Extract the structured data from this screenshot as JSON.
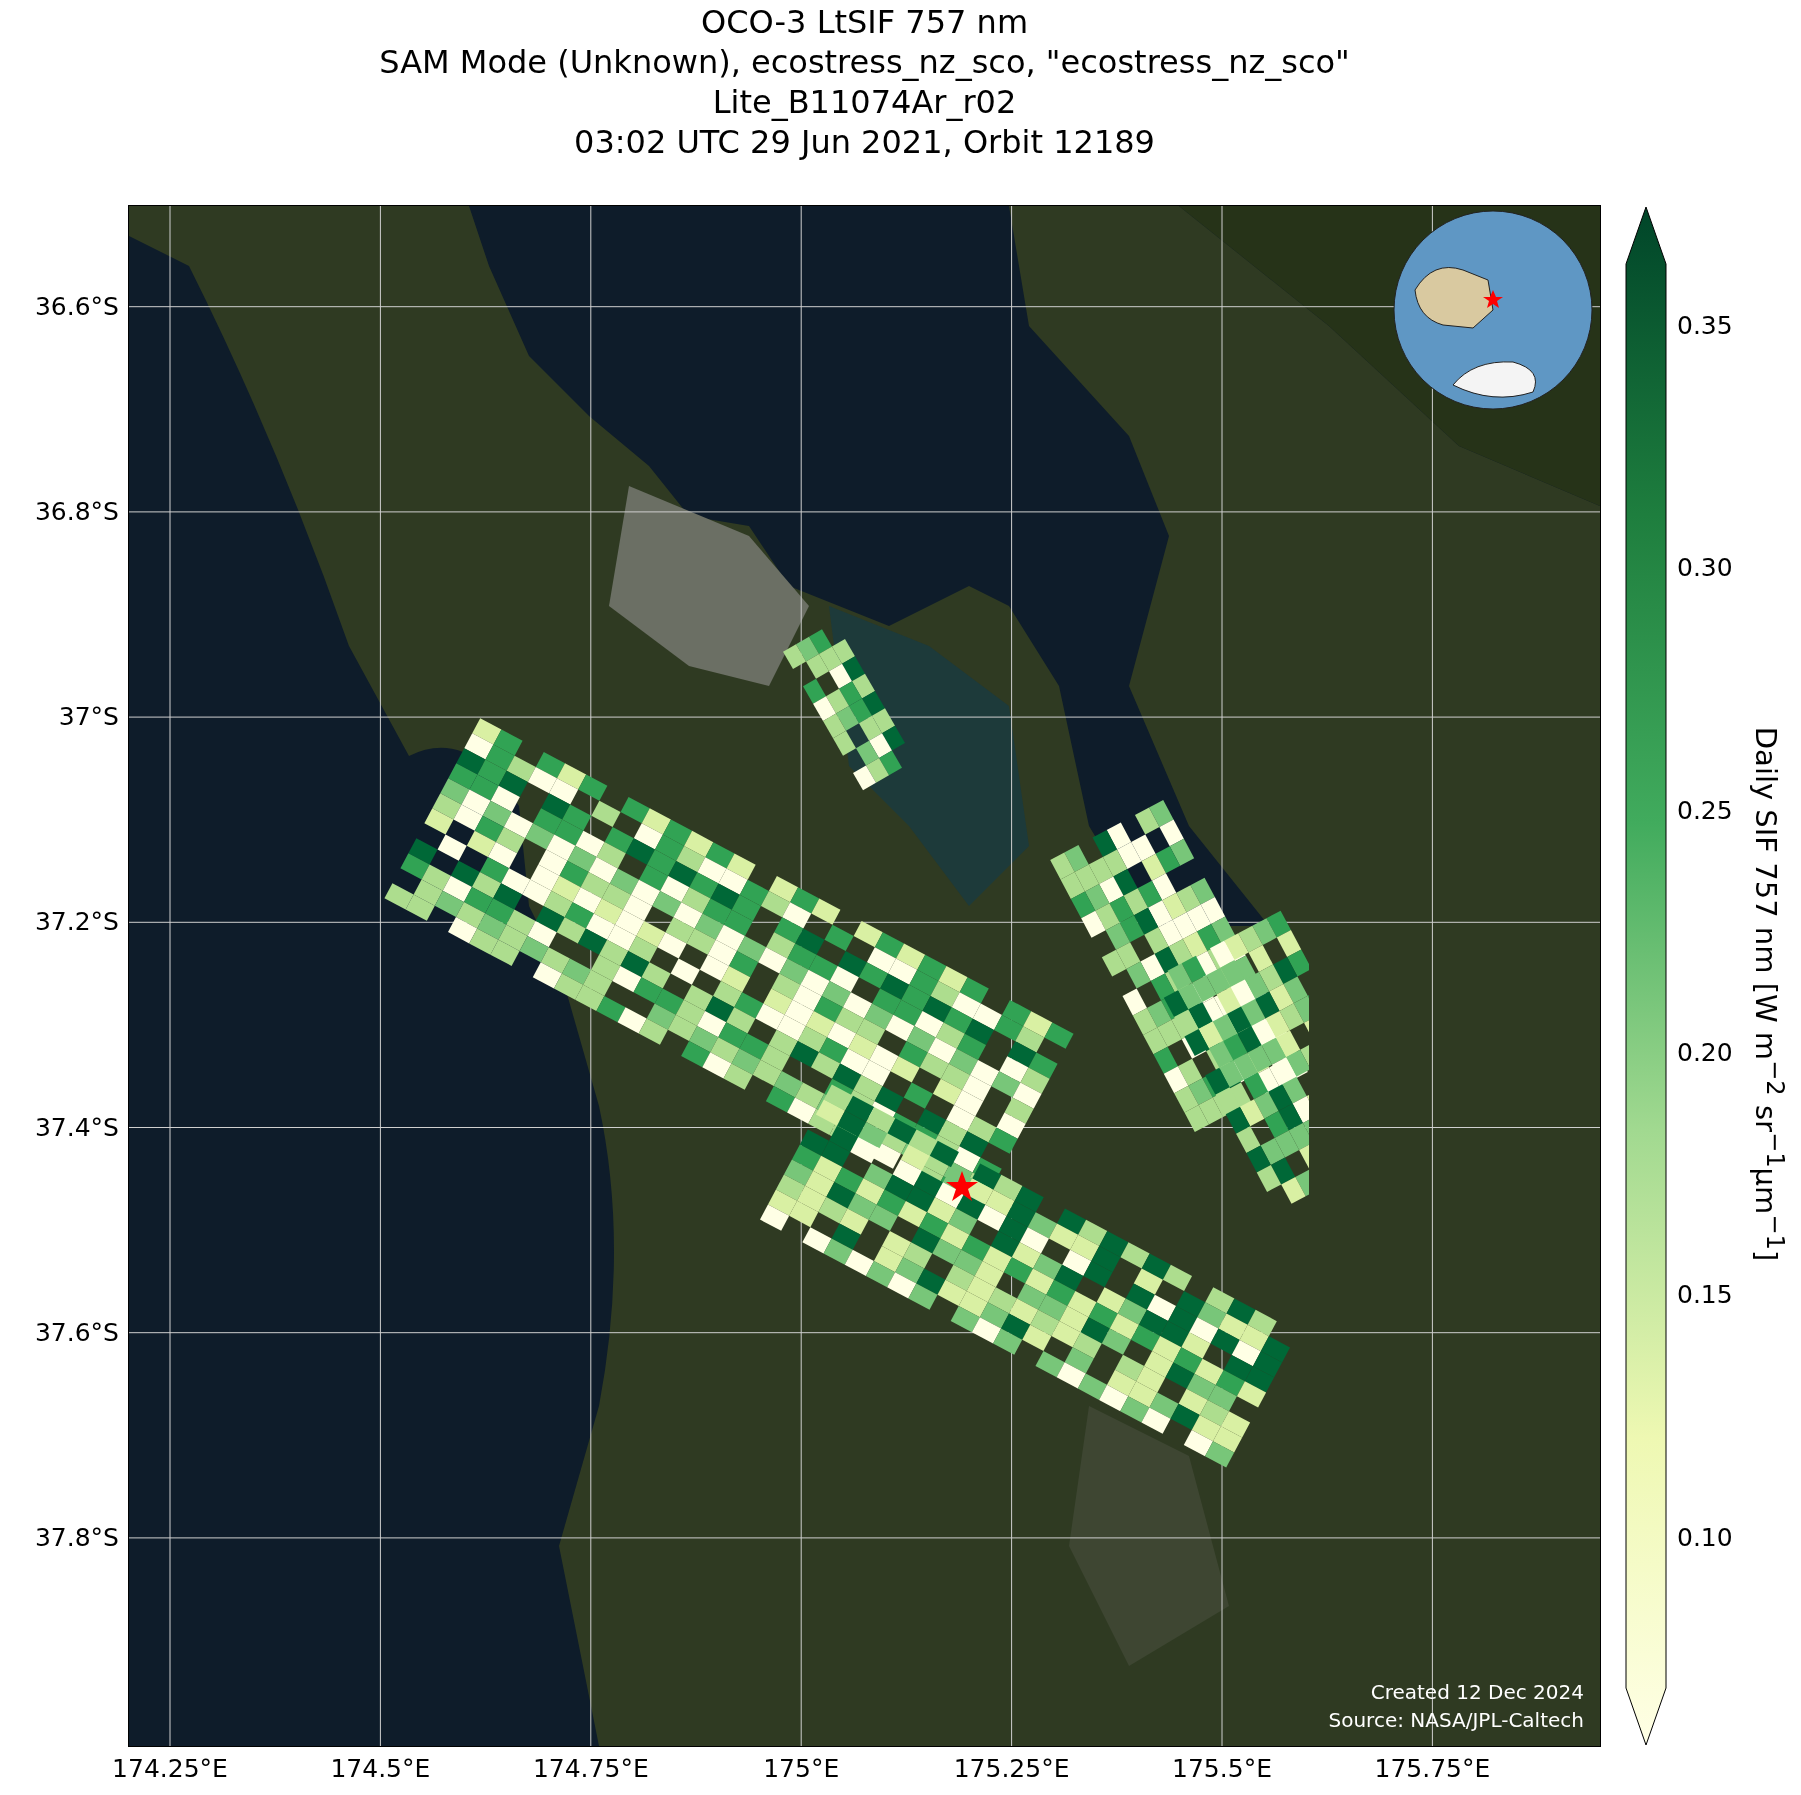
{
  "title_lines": [
    "OCO-3 LtSIF 757 nm",
    "SAM Mode (Unknown), ecostress_nz_sco, \"ecostress_nz_sco\"",
    "Lite_B11074Ar_r02",
    "03:02 UTC 29 Jun 2021, Orbit 12189"
  ],
  "map": {
    "lat_ticks": [
      "36.6°S",
      "36.8°S",
      "37°S",
      "37.2°S",
      "37.4°S",
      "37.6°S",
      "37.8°S"
    ],
    "lon_ticks": [
      "174.25°E",
      "174.5°E",
      "174.75°E",
      "175°E",
      "175.25°E",
      "175.5°E",
      "175.75°E"
    ],
    "credits": [
      "Created 12 Dec 2024",
      "Source: NASA/JPL-Caltech"
    ]
  },
  "colorbar": {
    "label": "Daily SIF 757 nm [W m$^{−2}$ sr$^{−1}$μm$^{−1}$]",
    "ticks": [
      "0.35",
      "0.30",
      "0.25",
      "0.20",
      "0.15",
      "0.10"
    ]
  }
}
